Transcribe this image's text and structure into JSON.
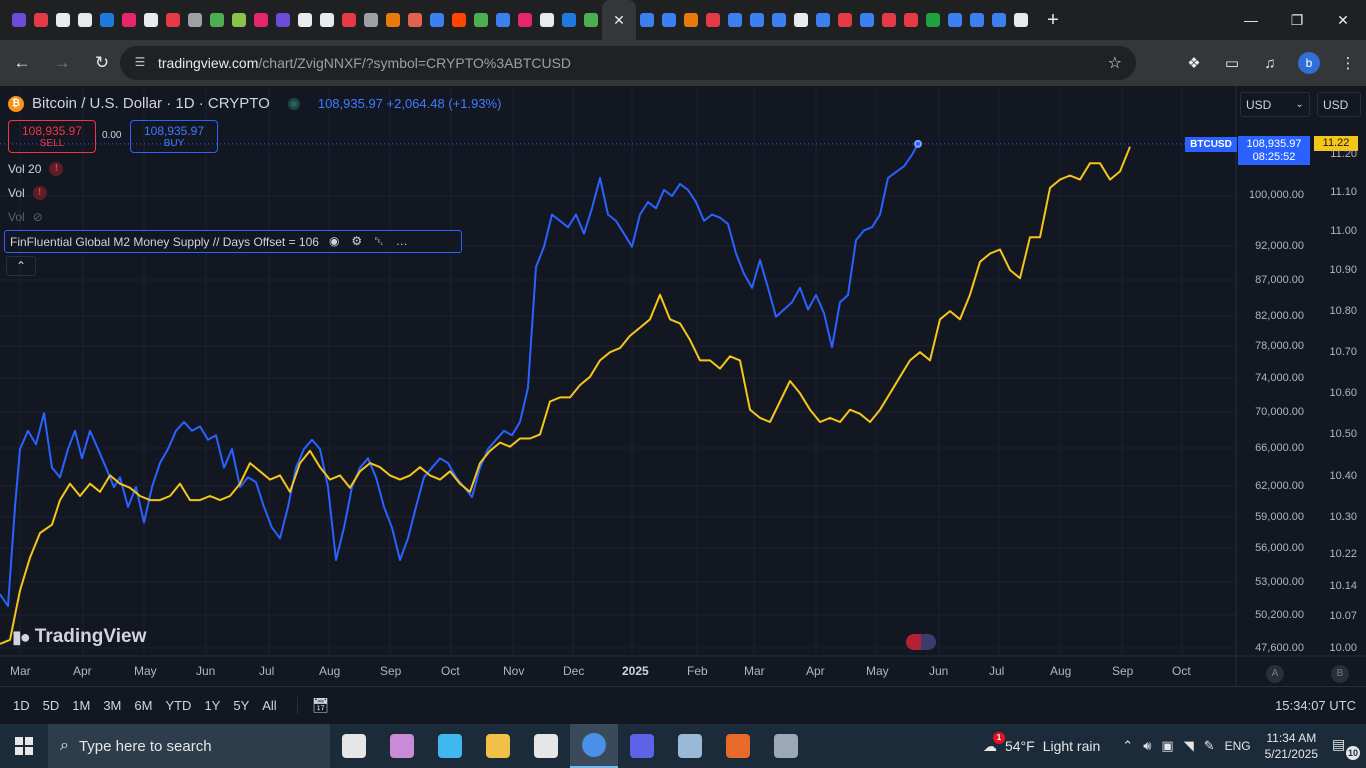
{
  "browser": {
    "active_tab_close": "✕",
    "new_tab": "+",
    "url_host": "tradingview.com",
    "url_path": "/chart/ZvigNNXF/?symbol=CRYPTO%3ABTCUSD",
    "profile_initial": "b"
  },
  "tab_icon_colors": [
    "#6b4bd8",
    "#e63946",
    "#e8eaed",
    "#e8eaed",
    "#1f7ae0",
    "#e6266b",
    "#e8eaed",
    "#e63946",
    "#9aa0a6",
    "#4caf50",
    "#8bc34a",
    "#e6266b",
    "#6b4bd8",
    "#e8eaed",
    "#e8eaed",
    "#e63946",
    "#9aa0a6",
    "#e8790b",
    "#e2624e",
    "#3c7ff0",
    "#ff4500",
    "#4caf50",
    "#3c7ff0",
    "#e6266b",
    "#e8eaed",
    "#1f7ae0",
    "#4caf50",
    "#3c7ff0",
    "#3c7ff0",
    "#e8790b",
    "#e63946",
    "#3c7ff0",
    "#3c7ff0",
    "#3c7ff0",
    "#e8eaed",
    "#3c7ff0",
    "#e63946",
    "#3c7ff0",
    "#e63946",
    "#e63946",
    "#1ea23e",
    "#3c7ff0",
    "#3c7ff0",
    "#3c7ff0",
    "#e8eaed"
  ],
  "chart": {
    "symbol_title": "Bitcoin / U.S. Dollar · 1D · CRYPTO",
    "header_price": "108,935.97 +2,064.48 (+1.93%)",
    "sell_price": "108,935.97",
    "sell_label": "SELL",
    "spread": "0.00",
    "buy_price": "108,935.97",
    "buy_label": "BUY",
    "indicators": [
      "Vol 20",
      "Vol",
      "Vol"
    ],
    "m2_indicator": "FinFluential Global M2 Money Supply // Days Offset = 106",
    "currency_left": "USD",
    "currency_right": "USD",
    "brand": "TradingView",
    "symbol_tag": "BTCUSD",
    "price_tag": "108,935.97",
    "countdown_tag": "08:25:52",
    "m2_tag": "11.22",
    "auto_label": "A",
    "log_label": "B",
    "colors": {
      "btc": "#2962ff",
      "m2": "#f5c518",
      "sell": "#f23645"
    }
  },
  "chart_data": {
    "type": "line",
    "y_axis_left_labels": [
      "100,000.00",
      "92,000.00",
      "87,000.00",
      "82,000.00",
      "78,000.00",
      "74,000.00",
      "70,000.00",
      "66,000.00",
      "62,000.00",
      "59,000.00",
      "56,000.00",
      "53,000.00",
      "50,200.00",
      "47,600.00"
    ],
    "y_axis_right_labels": [
      "11.20",
      "11.10",
      "11.00",
      "10.90",
      "10.80",
      "10.70",
      "10.60",
      "10.50",
      "10.40",
      "10.30",
      "10.22",
      "10.14",
      "10.07",
      "10.00"
    ],
    "x_axis_labels": [
      "Mar",
      "Apr",
      "May",
      "Jun",
      "Jul",
      "Aug",
      "Sep",
      "Oct",
      "Nov",
      "Dec",
      "2025",
      "Feb",
      "Mar",
      "Apr",
      "May",
      "Jun",
      "Jul",
      "Aug",
      "Sep",
      "Oct"
    ],
    "log_scale": true,
    "grid": true,
    "series": [
      {
        "name": "BTCUSD",
        "color": "#2962ff",
        "axis": "left",
        "points": [
          [
            0,
            52000
          ],
          [
            8,
            51000
          ],
          [
            15,
            60000
          ],
          [
            20,
            66000
          ],
          [
            28,
            68000
          ],
          [
            36,
            66500
          ],
          [
            44,
            70000
          ],
          [
            52,
            64000
          ],
          [
            60,
            63000
          ],
          [
            68,
            66000
          ],
          [
            75,
            68000
          ],
          [
            82,
            65000
          ],
          [
            90,
            68000
          ],
          [
            98,
            66000
          ],
          [
            106,
            64000
          ],
          [
            114,
            62000
          ],
          [
            120,
            63000
          ],
          [
            128,
            60000
          ],
          [
            136,
            62000
          ],
          [
            144,
            58500
          ],
          [
            152,
            62000
          ],
          [
            160,
            64500
          ],
          [
            168,
            66000
          ],
          [
            176,
            68000
          ],
          [
            184,
            69000
          ],
          [
            192,
            68000
          ],
          [
            200,
            68500
          ],
          [
            208,
            67000
          ],
          [
            216,
            67500
          ],
          [
            224,
            64000
          ],
          [
            232,
            66000
          ],
          [
            240,
            62000
          ],
          [
            248,
            63000
          ],
          [
            256,
            62500
          ],
          [
            264,
            60000
          ],
          [
            272,
            58000
          ],
          [
            280,
            57000
          ],
          [
            288,
            60000
          ],
          [
            296,
            64000
          ],
          [
            304,
            66000
          ],
          [
            312,
            67000
          ],
          [
            320,
            66000
          ],
          [
            328,
            62000
          ],
          [
            336,
            55000
          ],
          [
            344,
            58000
          ],
          [
            352,
            62000
          ],
          [
            360,
            64000
          ],
          [
            368,
            65000
          ],
          [
            376,
            63000
          ],
          [
            384,
            60000
          ],
          [
            392,
            58000
          ],
          [
            400,
            55000
          ],
          [
            408,
            57000
          ],
          [
            416,
            60000
          ],
          [
            424,
            63000
          ],
          [
            432,
            64000
          ],
          [
            440,
            65000
          ],
          [
            448,
            64500
          ],
          [
            456,
            63000
          ],
          [
            464,
            62000
          ],
          [
            472,
            61000
          ],
          [
            480,
            64000
          ],
          [
            488,
            66000
          ],
          [
            496,
            67000
          ],
          [
            504,
            68000
          ],
          [
            512,
            67500
          ],
          [
            520,
            69000
          ],
          [
            528,
            73000
          ],
          [
            536,
            89000
          ],
          [
            544,
            92000
          ],
          [
            552,
            97000
          ],
          [
            560,
            96000
          ],
          [
            568,
            95000
          ],
          [
            576,
            97000
          ],
          [
            584,
            94000
          ],
          [
            592,
            98000
          ],
          [
            600,
            103000
          ],
          [
            608,
            97000
          ],
          [
            616,
            96000
          ],
          [
            624,
            94000
          ],
          [
            632,
            92000
          ],
          [
            640,
            97000
          ],
          [
            648,
            99000
          ],
          [
            656,
            98000
          ],
          [
            664,
            101000
          ],
          [
            672,
            100000
          ],
          [
            680,
            102000
          ],
          [
            688,
            101000
          ],
          [
            696,
            99000
          ],
          [
            704,
            96000
          ],
          [
            712,
            97000
          ],
          [
            720,
            96500
          ],
          [
            728,
            95500
          ],
          [
            736,
            91000
          ],
          [
            744,
            88000
          ],
          [
            752,
            86000
          ],
          [
            760,
            90000
          ],
          [
            768,
            86000
          ],
          [
            776,
            82000
          ],
          [
            784,
            83000
          ],
          [
            792,
            84000
          ],
          [
            800,
            86000
          ],
          [
            808,
            83000
          ],
          [
            816,
            85000
          ],
          [
            824,
            82500
          ],
          [
            832,
            78000
          ],
          [
            840,
            84000
          ],
          [
            848,
            85000
          ],
          [
            856,
            93000
          ],
          [
            864,
            94500
          ],
          [
            872,
            95000
          ],
          [
            880,
            97000
          ],
          [
            888,
            103000
          ],
          [
            896,
            104000
          ],
          [
            904,
            105000
          ],
          [
            912,
            107000
          ],
          [
            918,
            108936
          ]
        ]
      },
      {
        "name": "M2",
        "color": "#f5c518",
        "axis": "right",
        "points": [
          [
            0,
            10.01
          ],
          [
            10,
            10.02
          ],
          [
            20,
            10.14
          ],
          [
            30,
            10.22
          ],
          [
            40,
            10.28
          ],
          [
            52,
            10.3
          ],
          [
            60,
            10.36
          ],
          [
            70,
            10.4
          ],
          [
            80,
            10.37
          ],
          [
            90,
            10.4
          ],
          [
            100,
            10.38
          ],
          [
            110,
            10.42
          ],
          [
            120,
            10.4
          ],
          [
            130,
            10.39
          ],
          [
            140,
            10.37
          ],
          [
            150,
            10.36
          ],
          [
            160,
            10.36
          ],
          [
            170,
            10.37
          ],
          [
            180,
            10.4
          ],
          [
            190,
            10.36
          ],
          [
            200,
            10.36
          ],
          [
            210,
            10.37
          ],
          [
            220,
            10.36
          ],
          [
            230,
            10.37
          ],
          [
            240,
            10.4
          ],
          [
            250,
            10.45
          ],
          [
            260,
            10.43
          ],
          [
            270,
            10.41
          ],
          [
            280,
            10.42
          ],
          [
            290,
            10.38
          ],
          [
            300,
            10.45
          ],
          [
            310,
            10.48
          ],
          [
            320,
            10.44
          ],
          [
            330,
            10.41
          ],
          [
            340,
            10.42
          ],
          [
            350,
            10.39
          ],
          [
            360,
            10.43
          ],
          [
            370,
            10.45
          ],
          [
            380,
            10.44
          ],
          [
            390,
            10.42
          ],
          [
            400,
            10.41
          ],
          [
            410,
            10.42
          ],
          [
            420,
            10.44
          ],
          [
            430,
            10.42
          ],
          [
            440,
            10.41
          ],
          [
            450,
            10.43
          ],
          [
            460,
            10.4
          ],
          [
            470,
            10.38
          ],
          [
            480,
            10.45
          ],
          [
            490,
            10.48
          ],
          [
            500,
            10.5
          ],
          [
            510,
            10.49
          ],
          [
            520,
            10.51
          ],
          [
            530,
            10.51
          ],
          [
            540,
            10.52
          ],
          [
            550,
            10.6
          ],
          [
            560,
            10.61
          ],
          [
            570,
            10.61
          ],
          [
            580,
            10.64
          ],
          [
            590,
            10.66
          ],
          [
            600,
            10.7
          ],
          [
            610,
            10.72
          ],
          [
            620,
            10.73
          ],
          [
            630,
            10.76
          ],
          [
            640,
            10.78
          ],
          [
            650,
            10.8
          ],
          [
            660,
            10.86
          ],
          [
            670,
            10.8
          ],
          [
            680,
            10.79
          ],
          [
            690,
            10.75
          ],
          [
            700,
            10.7
          ],
          [
            710,
            10.7
          ],
          [
            720,
            10.68
          ],
          [
            730,
            10.71
          ],
          [
            740,
            10.7
          ],
          [
            750,
            10.58
          ],
          [
            760,
            10.56
          ],
          [
            770,
            10.55
          ],
          [
            780,
            10.6
          ],
          [
            790,
            10.65
          ],
          [
            800,
            10.62
          ],
          [
            810,
            10.58
          ],
          [
            820,
            10.55
          ],
          [
            830,
            10.56
          ],
          [
            840,
            10.55
          ],
          [
            850,
            10.58
          ],
          [
            860,
            10.57
          ],
          [
            870,
            10.55
          ],
          [
            880,
            10.58
          ],
          [
            890,
            10.62
          ],
          [
            900,
            10.66
          ],
          [
            910,
            10.7
          ],
          [
            920,
            10.72
          ],
          [
            930,
            10.7
          ],
          [
            940,
            10.8
          ],
          [
            950,
            10.82
          ],
          [
            960,
            10.8
          ],
          [
            970,
            10.86
          ],
          [
            980,
            10.94
          ],
          [
            990,
            10.96
          ],
          [
            1000,
            10.97
          ],
          [
            1010,
            10.92
          ],
          [
            1020,
            10.9
          ],
          [
            1030,
            11.0
          ],
          [
            1040,
            11.0
          ],
          [
            1050,
            11.12
          ],
          [
            1060,
            11.14
          ],
          [
            1070,
            11.15
          ],
          [
            1080,
            11.14
          ],
          [
            1090,
            11.18
          ],
          [
            1100,
            11.18
          ],
          [
            1110,
            11.14
          ],
          [
            1120,
            11.16
          ],
          [
            1130,
            11.22
          ]
        ]
      }
    ]
  },
  "bottom_bar": {
    "ranges": [
      "1D",
      "5D",
      "1M",
      "3M",
      "6M",
      "YTD",
      "1Y",
      "5Y",
      "All"
    ],
    "utc_time": "15:34:07 UTC"
  },
  "taskbar": {
    "search_placeholder": "Type here to search",
    "icon_colors": [
      "#e6e6e6",
      "#c98bd8",
      "#3fb8f0",
      "#f0c048",
      "#e6e6e6",
      "#4a8fe8",
      "#5d63e8",
      "#9ab8d8",
      "#e86a2a",
      "#9aa8b8"
    ],
    "weather_temp": "54°F",
    "weather_desc": "Light rain",
    "language": "ENG",
    "time": "11:34 AM",
    "date": "5/21/2025",
    "notif_count": "10",
    "weather_badge": "1"
  }
}
